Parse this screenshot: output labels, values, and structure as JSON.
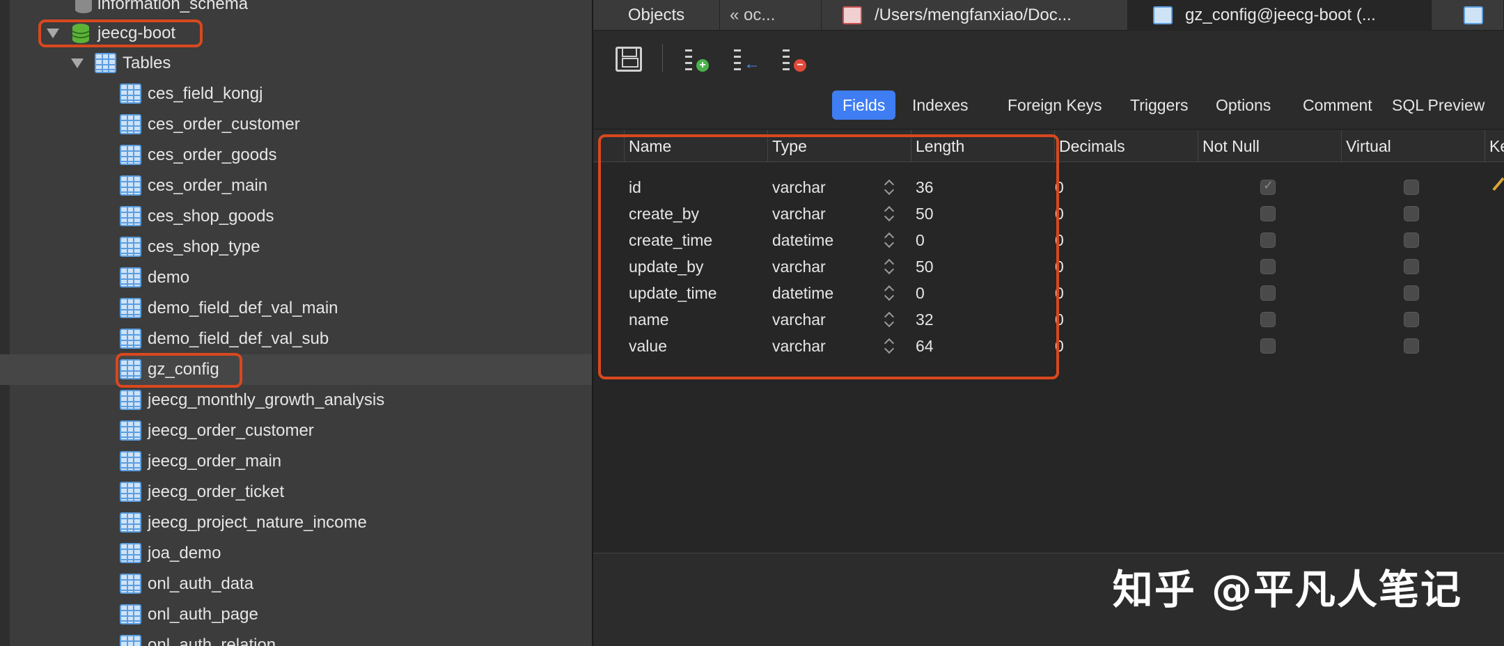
{
  "sidebar": {
    "top_item": "information_schema",
    "database": "jeecg-boot",
    "tables_group": "Tables",
    "tables": [
      "ces_field_kongj",
      "ces_order_customer",
      "ces_order_goods",
      "ces_order_main",
      "ces_shop_goods",
      "ces_shop_type",
      "demo",
      "demo_field_def_val_main",
      "demo_field_def_val_sub",
      "gz_config",
      "jeecg_monthly_growth_analysis",
      "jeecg_order_customer",
      "jeecg_order_main",
      "jeecg_order_ticket",
      "jeecg_project_nature_income",
      "joa_demo",
      "onl_auth_data",
      "onl_auth_page",
      "onl_auth_relation"
    ],
    "selected_table": "gz_config"
  },
  "tabbar": {
    "objects": "Objects",
    "back": "« oc...",
    "file_path": "/Users/mengfanxiao/Doc...",
    "design_tab": "gz_config@jeecg-boot (..."
  },
  "designer_tabs": [
    "Fields",
    "Indexes",
    "Foreign Keys",
    "Triggers",
    "Options",
    "Comment",
    "SQL Preview"
  ],
  "active_designer_tab": "Fields",
  "grid": {
    "columns": [
      "Name",
      "Type",
      "Length",
      "Decimals",
      "Not Null",
      "Virtual",
      "Ke"
    ],
    "rows": [
      {
        "name": "id",
        "type": "varchar",
        "length": "36",
        "decimals": "0",
        "not_null": true,
        "virtual": false,
        "key": true
      },
      {
        "name": "create_by",
        "type": "varchar",
        "length": "50",
        "decimals": "0",
        "not_null": false,
        "virtual": false,
        "key": false
      },
      {
        "name": "create_time",
        "type": "datetime",
        "length": "0",
        "decimals": "0",
        "not_null": false,
        "virtual": false,
        "key": false
      },
      {
        "name": "update_by",
        "type": "varchar",
        "length": "50",
        "decimals": "0",
        "not_null": false,
        "virtual": false,
        "key": false
      },
      {
        "name": "update_time",
        "type": "datetime",
        "length": "0",
        "decimals": "0",
        "not_null": false,
        "virtual": false,
        "key": false
      },
      {
        "name": "name",
        "type": "varchar",
        "length": "32",
        "decimals": "0",
        "not_null": false,
        "virtual": false,
        "key": false
      },
      {
        "name": "value",
        "type": "varchar",
        "length": "64",
        "decimals": "0",
        "not_null": false,
        "virtual": false,
        "key": false
      }
    ]
  },
  "watermark": "知乎 @平凡人笔记",
  "colors": {
    "accent": "#3f7df2",
    "highlight_box": "#d9481e",
    "sidebar_bg": "#3c3c3c",
    "main_bg": "#262626"
  },
  "icons": {
    "save": "save-icon",
    "add_field": "add-field-icon",
    "insert_field": "insert-field-icon",
    "delete_field": "delete-field-icon"
  }
}
